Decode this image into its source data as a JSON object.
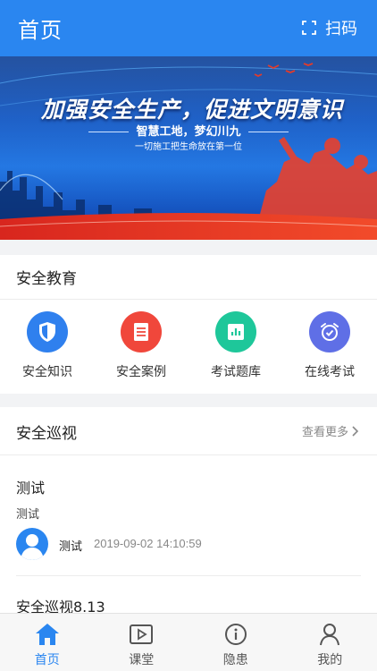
{
  "header": {
    "title": "首页",
    "scan_label": "扫码"
  },
  "banner": {
    "headline": "加强安全生产，促进文明意识",
    "subtitle": "智慧工地，梦幻川九",
    "tagline": "一切施工把生命放在第一位"
  },
  "education": {
    "title": "安全教育",
    "items": [
      {
        "label": "安全知识",
        "icon": "shield-icon",
        "color": "#2f80ee"
      },
      {
        "label": "安全案例",
        "icon": "document-icon",
        "color": "#f0473b"
      },
      {
        "label": "考试题库",
        "icon": "chart-icon",
        "color": "#1ec79a"
      },
      {
        "label": "在线考试",
        "icon": "alarm-clock-icon",
        "color": "#5f6fe6"
      }
    ]
  },
  "patrol": {
    "title": "安全巡视",
    "more_label": "查看更多",
    "items": [
      {
        "title": "测试",
        "desc": "测试",
        "author": "测试",
        "time": "2019-09-02 14:10:59"
      },
      {
        "title": "安全巡视8.13"
      }
    ]
  },
  "tabbar": {
    "items": [
      {
        "label": "首页",
        "icon": "home-icon",
        "active": true
      },
      {
        "label": "课堂",
        "icon": "video-play-icon",
        "active": false
      },
      {
        "label": "隐患",
        "icon": "info-icon",
        "active": false
      },
      {
        "label": "我的",
        "icon": "user-icon",
        "active": false
      }
    ]
  },
  "colors": {
    "primary": "#2a86f0"
  }
}
